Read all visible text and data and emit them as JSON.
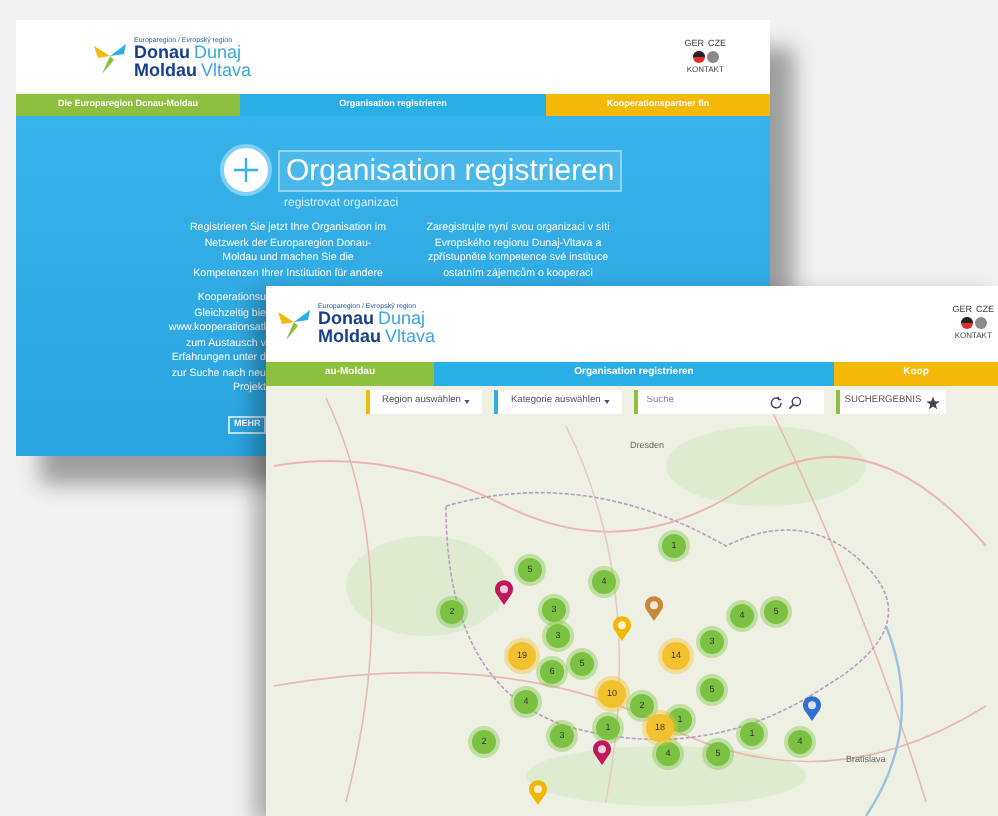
{
  "back_page": {
    "logo": {
      "tagline": "Europaregion / Evropský region",
      "words": [
        [
          "Donau",
          "Dunaj"
        ],
        [
          "Moldau",
          "Vltava"
        ]
      ]
    },
    "languages": [
      "GER",
      "CZE"
    ],
    "contact": "KONTAKT",
    "nav": [
      {
        "label": "Die Europaregion Donau-Moldau",
        "color": "#8dc03f"
      },
      {
        "label": "Organisation registrieren",
        "color": "#29aee6"
      },
      {
        "label": "Kooperationspartner fin",
        "color": "#f5b90a"
      }
    ],
    "title": "Organisation registrieren",
    "subtitle": "registrovat organizaci",
    "left_lines": [
      "Registrieren Sie jetzt Ihre Organisation im",
      "Netzwerk der Europaregion Donau-",
      "Moldau und machen Sie die",
      "Kompetenzen Ihrer Institution für andere"
    ],
    "left_cut_lines": [
      "Kooperationsu",
      "Gleichzeitig bie",
      "www.kooperationsatl",
      "zum Austausch v",
      "Erfahrungen unter d",
      "zur Suche nach neu",
      "Projekt"
    ],
    "right_lines": [
      "Zaregistrujte nyní svou organizaci v síti",
      "Evropského regionu Dunaj-Vltava a",
      "zpřístupněte kompetence své instituce",
      "ostatním zájemcům o kooperaci"
    ],
    "button": "MEHR"
  },
  "front_page": {
    "logo": {
      "tagline": "Europaregion / Evropský region",
      "words": [
        [
          "Donau",
          "Dunaj"
        ],
        [
          "Moldau",
          "Vltava"
        ]
      ]
    },
    "languages": [
      "GER",
      "CZE"
    ],
    "contact": "KONTAKT",
    "nav": [
      {
        "label": "au-Moldau",
        "color": "#8dc03f"
      },
      {
        "label": "Organisation registrieren",
        "color": "#29aee6"
      },
      {
        "label": "Koop",
        "color": "#f5b90a"
      }
    ],
    "toolbar": {
      "region": "Region auswählen",
      "category": "Kategorie auswählen",
      "search_placeholder": "Suche",
      "results": "SUCHERGEBNIS"
    },
    "map": {
      "places": [
        "Dresden",
        "Bratislava"
      ],
      "markers": [
        {
          "kind": "cluster",
          "label": "1",
          "color": "#7cc242"
        },
        {
          "kind": "cluster",
          "label": "5",
          "color": "#7cc242"
        },
        {
          "kind": "cluster",
          "label": "4",
          "color": "#7cc242"
        },
        {
          "kind": "cluster",
          "label": "2",
          "color": "#7cc242"
        },
        {
          "kind": "cluster",
          "label": "3",
          "color": "#7cc242"
        },
        {
          "kind": "cluster",
          "label": "3",
          "color": "#7cc242"
        },
        {
          "kind": "cluster",
          "label": "5",
          "color": "#7cc242"
        },
        {
          "kind": "cluster",
          "label": "6",
          "color": "#7cc242"
        },
        {
          "kind": "cluster",
          "label": "4",
          "color": "#7cc242"
        },
        {
          "kind": "cluster",
          "label": "2",
          "color": "#7cc242"
        },
        {
          "kind": "cluster",
          "label": "1",
          "color": "#7cc242"
        },
        {
          "kind": "cluster",
          "label": "3",
          "color": "#7cc242"
        },
        {
          "kind": "cluster",
          "label": "4",
          "color": "#7cc242"
        },
        {
          "kind": "cluster",
          "label": "5",
          "color": "#7cc242"
        },
        {
          "kind": "cluster",
          "label": "5",
          "color": "#7cc242"
        },
        {
          "kind": "cluster",
          "label": "1",
          "color": "#7cc242"
        },
        {
          "kind": "cluster",
          "label": "3",
          "color": "#7cc242"
        },
        {
          "kind": "cluster",
          "label": "2",
          "color": "#7cc242"
        },
        {
          "kind": "cluster",
          "label": "4",
          "color": "#7cc242"
        },
        {
          "kind": "cluster",
          "label": "5",
          "color": "#7cc242"
        },
        {
          "kind": "cluster",
          "label": "1",
          "color": "#7cc242"
        },
        {
          "kind": "cluster",
          "label": "4",
          "color": "#7cc242"
        },
        {
          "kind": "cluster",
          "label": "19",
          "color": "#f2c12e"
        },
        {
          "kind": "cluster",
          "label": "14",
          "color": "#f2c12e"
        },
        {
          "kind": "cluster",
          "label": "10",
          "color": "#f2c12e"
        },
        {
          "kind": "cluster",
          "label": "18",
          "color": "#f2c12e"
        },
        {
          "kind": "pin",
          "color": "#c2185b"
        },
        {
          "kind": "pin",
          "color": "#c8883a"
        },
        {
          "kind": "pin",
          "color": "#f2b705"
        },
        {
          "kind": "pin",
          "color": "#2f6fd0"
        },
        {
          "kind": "pin",
          "color": "#c2185b"
        },
        {
          "kind": "pin",
          "color": "#f2b705"
        }
      ]
    }
  }
}
